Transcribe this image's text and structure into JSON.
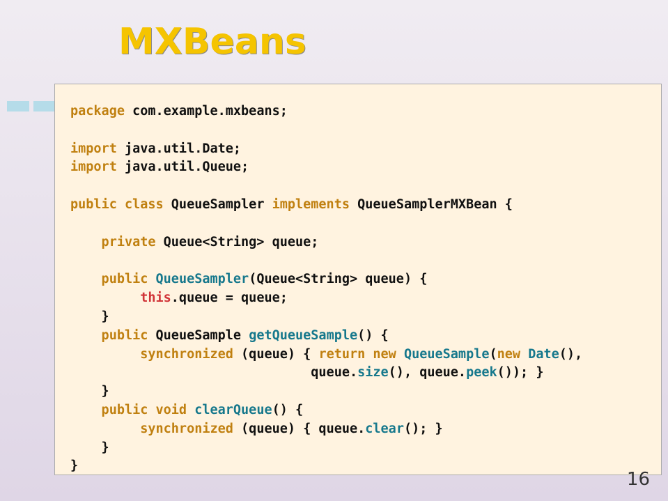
{
  "title": "MXBeans",
  "page_number": "16",
  "code": {
    "l1_kw": "package ",
    "l1_txt": "com.example.mxbeans;",
    "l3_kw": "import ",
    "l3_txt": "java.util.Date;",
    "l4_kw": "import ",
    "l4_txt": "java.util.Queue;",
    "l6_kw": "public class ",
    "l6_txt": "QueueSampler ",
    "l6_kw2": "implements ",
    "l6_txt2": "QueueSamplerMXBean {",
    "l8_kw": "    private ",
    "l8_txt": "Queue<String> queue;",
    "l10_kw": "    public ",
    "l10_mtd": "QueueSampler",
    "l10_txt": "(Queue<String> queue) {",
    "l11_this": "         this",
    "l11_txt": ".queue = queue;",
    "l12_txt": "    }",
    "l13_kw": "    public ",
    "l13_txt": "QueueSample ",
    "l13_mtd": "getQueueSample",
    "l13_txt2": "() {",
    "l14_kw": "         synchronized ",
    "l14_txt": "(queue) { ",
    "l14_kw2": "return new ",
    "l14_mtd": "QueueSample",
    "l14_txt2": "(",
    "l14_kw3": "new ",
    "l14_mtd2": "Date",
    "l14_txt3": "(),",
    "l15_txt": "                               queue.",
    "l15_mtd": "size",
    "l15_txt2": "(), queue.",
    "l15_mtd2": "peek",
    "l15_txt3": "()); }",
    "l16_txt": "    }",
    "l17_kw": "    public void ",
    "l17_mtd": "clearQueue",
    "l17_txt": "() {",
    "l18_kw": "         synchronized ",
    "l18_txt": "(queue) { queue.",
    "l18_mtd": "clear",
    "l18_txt2": "(); }",
    "l19_txt": "    }",
    "l20_txt": "}"
  }
}
